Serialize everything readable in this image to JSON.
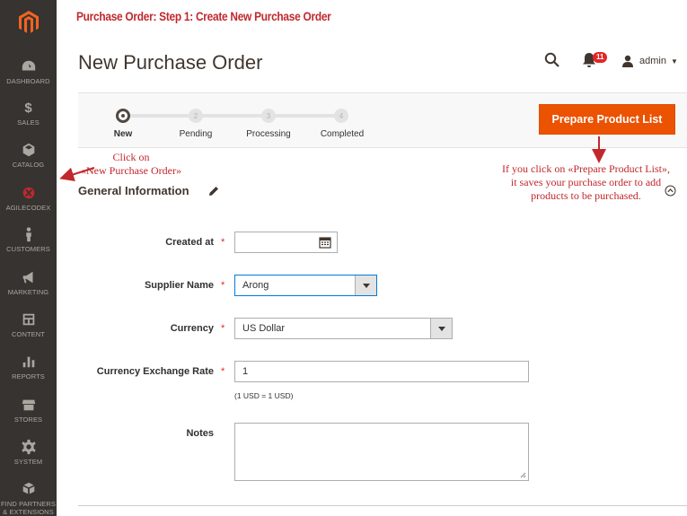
{
  "doc_title": "Purchase Order: Step 1: Create New Purchase Order",
  "page_title": "New Purchase Order",
  "header": {
    "notification_count": "11",
    "user_name": "admin"
  },
  "sidebar": {
    "items": [
      {
        "label": "DASHBOARD",
        "icon": "dashboard-icon"
      },
      {
        "label": "SALES",
        "icon": "dollar-icon"
      },
      {
        "label": "CATALOG",
        "icon": "box-icon"
      },
      {
        "label": "AGILECODEX",
        "icon": "agilecodex-icon"
      },
      {
        "label": "CUSTOMERS",
        "icon": "person-icon"
      },
      {
        "label": "MARKETING",
        "icon": "megaphone-icon"
      },
      {
        "label": "CONTENT",
        "icon": "layout-icon"
      },
      {
        "label": "REPORTS",
        "icon": "bar-chart-icon"
      },
      {
        "label": "STORES",
        "icon": "store-icon"
      },
      {
        "label": "SYSTEM",
        "icon": "gear-icon"
      },
      {
        "label": "FIND PARTNERS",
        "label2": "& EXTENSIONS",
        "icon": "cubes-icon"
      }
    ]
  },
  "steps": [
    {
      "label": "New",
      "number": "",
      "active": true
    },
    {
      "label": "Pending",
      "number": "2",
      "active": false
    },
    {
      "label": "Processing",
      "number": "3",
      "active": false
    },
    {
      "label": "Completed",
      "number": "4",
      "active": false
    }
  ],
  "prepare_button_label": "Prepare Product List",
  "annotations": {
    "left_line1": "Click on",
    "left_line2": "«New Purchase Order»",
    "right_line1": "If you click on «Prepare Product List»,",
    "right_line2": "it saves your purchase order to add",
    "right_line3": "products to be purchased."
  },
  "section_title": "General Information",
  "form": {
    "created_at": {
      "label": "Created at",
      "value": ""
    },
    "supplier_name": {
      "label": "Supplier Name",
      "value": "Arong"
    },
    "currency": {
      "label": "Currency",
      "value": "US Dollar"
    },
    "exchange_rate": {
      "label": "Currency Exchange Rate",
      "value": "1",
      "note": "(1 USD = 1 USD)"
    },
    "notes": {
      "label": "Notes",
      "value": ""
    },
    "required_mark": "*"
  },
  "colors": {
    "sidebar_bg": "#373330",
    "accent_orange": "#eb5202",
    "annotation_red": "#c0282d"
  }
}
